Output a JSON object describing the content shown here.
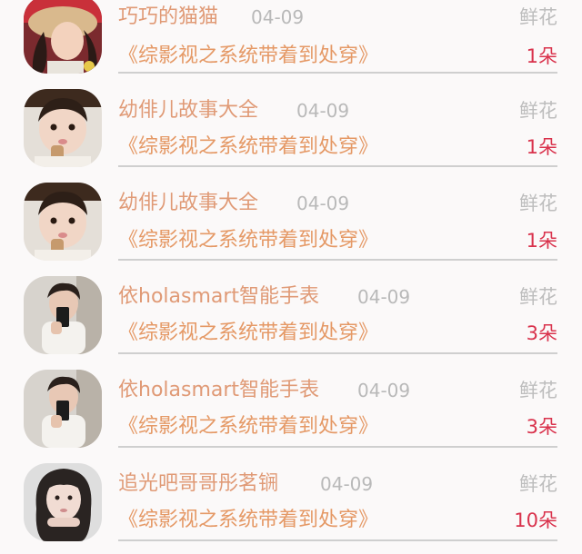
{
  "gifts": [
    {
      "name": "巧巧的猫猫",
      "date": "04-09",
      "gift": "鲜花",
      "book": "《综影视之系统带着到处穿》",
      "count": "1朵",
      "avatar_icon": "girl-with-hat-avatar"
    },
    {
      "name": "幼俳儿故事大全",
      "date": "04-09",
      "gift": "鲜花",
      "book": "《综影视之系统带着到处穿》",
      "count": "1朵",
      "avatar_icon": "child-avatar"
    },
    {
      "name": "幼俳儿故事大全",
      "date": "04-09",
      "gift": "鲜花",
      "book": "《综影视之系统带着到处穿》",
      "count": "1朵",
      "avatar_icon": "child-avatar"
    },
    {
      "name": "依holasmart智能手表",
      "date": "04-09",
      "gift": "鲜花",
      "book": "《综影视之系统带着到处穿》",
      "count": "3朵",
      "avatar_icon": "man-selfie-avatar"
    },
    {
      "name": "依holasmart智能手表",
      "date": "04-09",
      "gift": "鲜花",
      "book": "《综影视之系统带着到处穿》",
      "count": "3朵",
      "avatar_icon": "man-selfie-avatar"
    },
    {
      "name": "追光吧哥哥彤茗锎",
      "date": "04-09",
      "gift": "鲜花",
      "book": "《综影视之系统带着到处穿》",
      "count": "10朵",
      "avatar_icon": "woman-portrait-avatar"
    }
  ],
  "colors": {
    "name": "#e09a76",
    "book": "#e59966",
    "count": "#d9324c",
    "muted": "#bdbdbd"
  }
}
